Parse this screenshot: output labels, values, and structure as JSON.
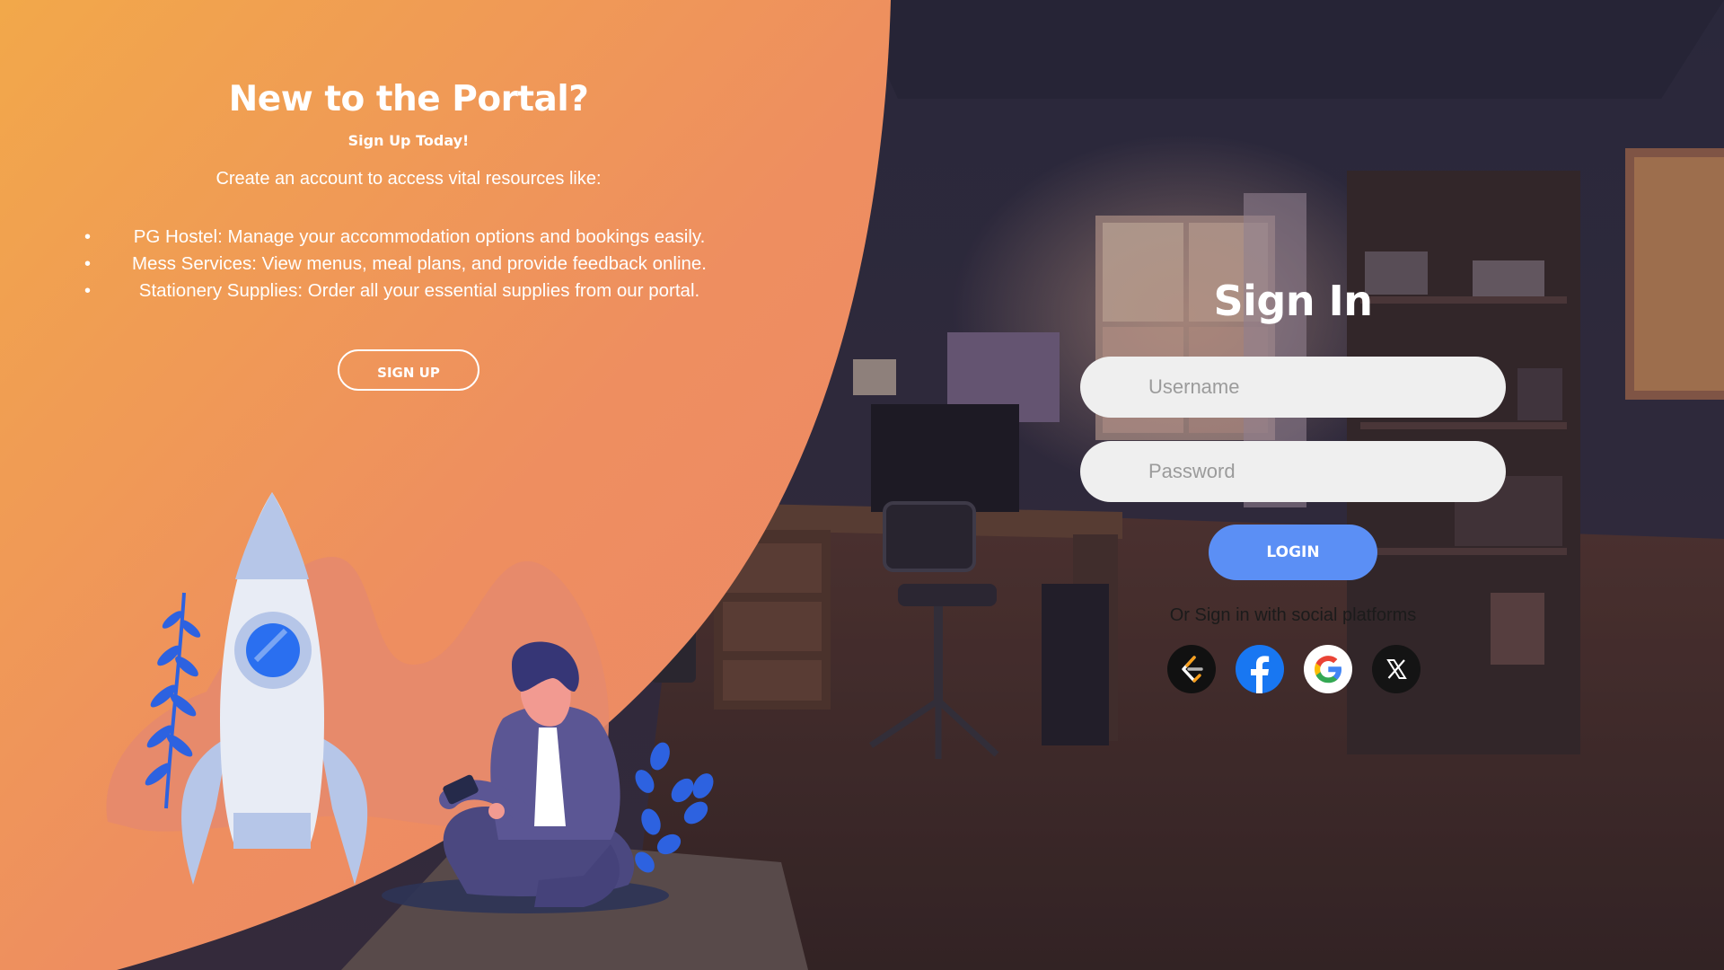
{
  "left_panel": {
    "title": "New to the Portal?",
    "subtitle": "Sign Up Today!",
    "intro": "Create an account to access vital resources like:",
    "benefits": [
      "PG Hostel: Manage your accommodation options and bookings easily.",
      "Mess Services: View menus, meal plans, and provide feedback online.",
      "Stationery Supplies: Order all your essential supplies from our portal."
    ],
    "signup_label": "SIGN UP"
  },
  "sign_in": {
    "title": "Sign In",
    "username_placeholder": "Username",
    "password_placeholder": "Password",
    "login_label": "LOGIN",
    "social_text": "Or Sign in with social platforms",
    "social_platforms": [
      "leetcode-icon",
      "facebook-icon",
      "google-icon",
      "x-icon"
    ]
  },
  "colors": {
    "orange_start": "#f2a84a",
    "orange_end": "#ee8a62",
    "login_button": "#5b8ff5",
    "input_background": "#efefef"
  }
}
